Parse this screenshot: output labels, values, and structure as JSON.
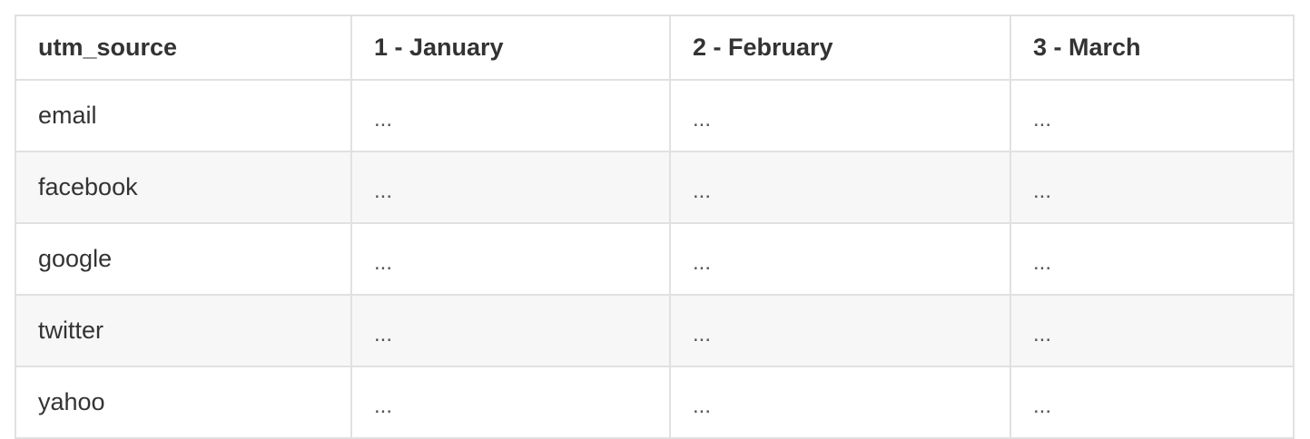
{
  "table": {
    "headers": [
      "utm_source",
      "1 - January",
      "2 - February",
      "3 - March"
    ],
    "rows": [
      [
        "email",
        "...",
        "...",
        "..."
      ],
      [
        "facebook",
        "...",
        "...",
        "..."
      ],
      [
        "google",
        "...",
        "...",
        "..."
      ],
      [
        "twitter",
        "...",
        "...",
        "..."
      ],
      [
        "yahoo",
        "...",
        "...",
        "..."
      ]
    ]
  }
}
